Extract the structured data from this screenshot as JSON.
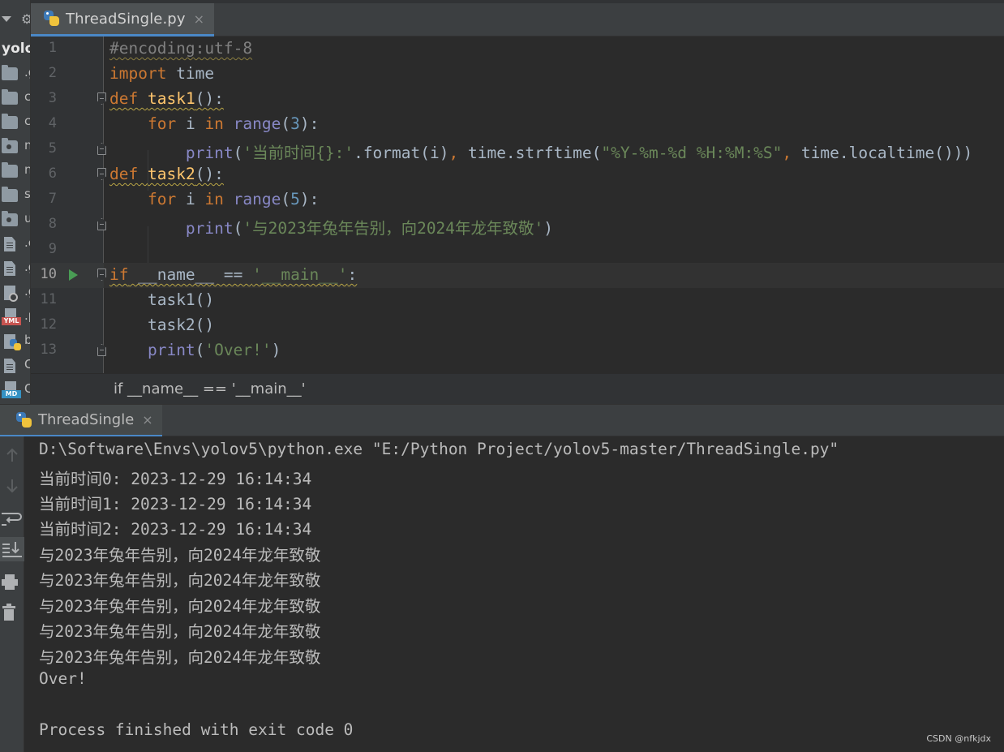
{
  "window": {
    "editor_tab": "ThreadSingle.py",
    "tab_close": "×"
  },
  "project": {
    "name": "yolo",
    "items": [
      {
        "label": ".g",
        "icon": "folder-icon"
      },
      {
        "label": "c",
        "icon": "folder-icon"
      },
      {
        "label": "c",
        "icon": "folder-icon"
      },
      {
        "label": "n",
        "icon": "package-folder-icon"
      },
      {
        "label": "n",
        "icon": "folder-icon"
      },
      {
        "label": "s",
        "icon": "folder-icon"
      },
      {
        "label": "u",
        "icon": "package-folder-icon"
      },
      {
        "label": ".c",
        "icon": "file-icon"
      },
      {
        "label": ".g",
        "icon": "file-icon"
      },
      {
        "label": ".g",
        "icon": "gitignore-file-icon"
      },
      {
        "label": ".p",
        "icon": "yaml-file-icon"
      },
      {
        "label": "b",
        "icon": "python-file-icon"
      },
      {
        "label": "C",
        "icon": "file-icon"
      },
      {
        "label": "C",
        "icon": "markdown-file-icon"
      }
    ]
  },
  "editor": {
    "current_line": 10,
    "lines": [
      {
        "n": "1"
      },
      {
        "n": "2"
      },
      {
        "n": "3"
      },
      {
        "n": "4"
      },
      {
        "n": "5"
      },
      {
        "n": "6"
      },
      {
        "n": "7"
      },
      {
        "n": "8"
      },
      {
        "n": "9"
      },
      {
        "n": "10"
      },
      {
        "n": "11"
      },
      {
        "n": "12"
      },
      {
        "n": "13"
      }
    ],
    "code": {
      "l1": {
        "comment": "#encoding:utf-8"
      },
      "l2": {
        "kw": "import",
        "name": " time"
      },
      "l3": {
        "kw": "def",
        "fn": "task1",
        "rest": "():"
      },
      "l4": {
        "indent": "    ",
        "kw1": "for",
        "var": " i ",
        "kw2": "in",
        "sp": " ",
        "bi": "range",
        "p1": "(",
        "num": "3",
        "p2": "):"
      },
      "l5": {
        "indent": "        ",
        "bi": "print",
        "p1": "(",
        "s1": "'当前时间{}:'",
        "m1": ".format(i)",
        "c1": ",",
        "m2": " time.strftime(",
        "s2": "\"%Y-%m-%d %H:%M:%S\"",
        "c2": ",",
        "m3": " time.localtime()))"
      },
      "l6": {
        "kw": "def",
        "fn": "task2",
        "rest": "():"
      },
      "l7": {
        "indent": "    ",
        "kw1": "for",
        "var": " i ",
        "kw2": "in",
        "sp": " ",
        "bi": "range",
        "p1": "(",
        "num": "5",
        "p2": "):"
      },
      "l8": {
        "indent": "        ",
        "bi": "print",
        "p1": "(",
        "s1": "'与2023年兔年告别，向2024年龙年致敬'",
        "p2": ")"
      },
      "l10": {
        "kw": "if",
        "mid": " __name__ == ",
        "str": "'__main__'",
        "rest": ":"
      },
      "l11": {
        "indent": "    ",
        "call": "task1()"
      },
      "l12": {
        "indent": "    ",
        "call": "task2()"
      },
      "l13": {
        "indent": "    ",
        "bi": "print",
        "p1": "(",
        "s1": "'Over!'",
        "p2": ")"
      }
    }
  },
  "breadcrumb": "if __name__ == '__main__'",
  "run": {
    "tab": "ThreadSingle",
    "console_lines": [
      "D:\\Software\\Envs\\yolov5\\python.exe \"E:/Python Project/yolov5-master/ThreadSingle.py\"",
      "当前时间0: 2023-12-29 16:14:34",
      "当前时间1: 2023-12-29 16:14:34",
      "当前时间2: 2023-12-29 16:14:34",
      "与2023年兔年告别，向2024年龙年致敬",
      "与2023年兔年告别，向2024年龙年致敬",
      "与2023年兔年告别，向2024年龙年致敬",
      "与2023年兔年告别，向2024年龙年致敬",
      "与2023年兔年告别，向2024年龙年致敬",
      "Over!",
      "",
      "Process finished with exit code 0"
    ],
    "tools": [
      "scroll-up-icon",
      "scroll-down-icon",
      "soft-wrap-icon",
      "scroll-to-end-icon",
      "print-icon",
      "trash-icon"
    ]
  },
  "watermark": "CSDN @nfkjdx",
  "colors": {
    "keyword": "#cc7832",
    "function": "#ffc66d",
    "number": "#6897bb",
    "string": "#6a8759",
    "builtin": "#8888c6",
    "comment": "#808080",
    "run_arrow": "#499c54",
    "tab_accent": "#4a88c7"
  }
}
